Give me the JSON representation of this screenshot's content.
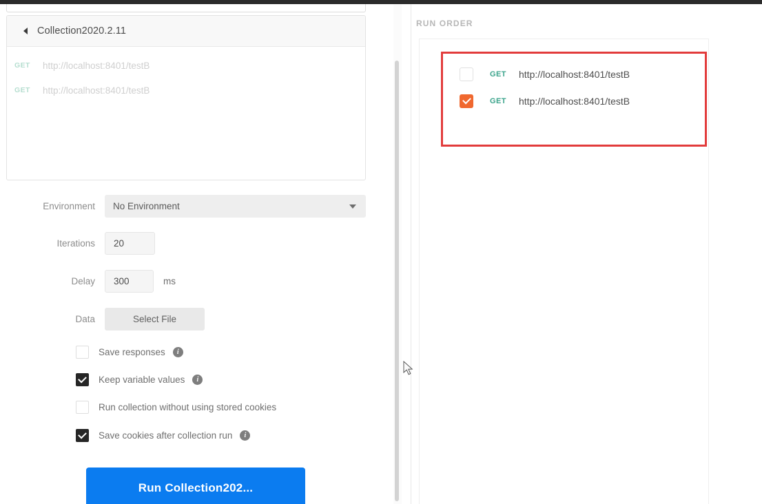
{
  "window": {
    "accent_blue": "#0b7cf0",
    "accent_orange": "#f0682f",
    "annotation_red": "#e23b3b",
    "method_teal": "#3aa38b"
  },
  "left_panel": {
    "collection": {
      "back_icon": "caret-left-icon",
      "title": "Collection2020.2.11",
      "requests": [
        {
          "method": "GET",
          "url": "http://localhost:8401/testB"
        },
        {
          "method": "GET",
          "url": "http://localhost:8401/testB"
        }
      ]
    },
    "form": {
      "environment": {
        "label": "Environment",
        "value": "No Environment",
        "caret_icon": "chevron-down-icon"
      },
      "iterations": {
        "label": "Iterations",
        "value": "20"
      },
      "delay": {
        "label": "Delay",
        "value": "300",
        "unit": "ms"
      },
      "data": {
        "label": "Data",
        "button_label": "Select File"
      }
    },
    "options": [
      {
        "label": "Save responses",
        "checked": false,
        "has_info": true,
        "info_icon": "info-icon"
      },
      {
        "label": "Keep variable values",
        "checked": true,
        "has_info": true,
        "info_icon": "info-icon"
      },
      {
        "label": "Run collection without using stored cookies",
        "checked": false,
        "has_info": false,
        "info_icon": "info-icon"
      },
      {
        "label": "Save cookies after collection run",
        "checked": true,
        "has_info": true,
        "info_icon": "info-icon"
      }
    ],
    "run_button": {
      "label": "Run Collection202..."
    }
  },
  "right_panel": {
    "title": "RUN ORDER",
    "items": [
      {
        "method": "GET",
        "url": "http://localhost:8401/testB",
        "checked": false
      },
      {
        "method": "GET",
        "url": "http://localhost:8401/testB",
        "checked": true
      }
    ]
  }
}
